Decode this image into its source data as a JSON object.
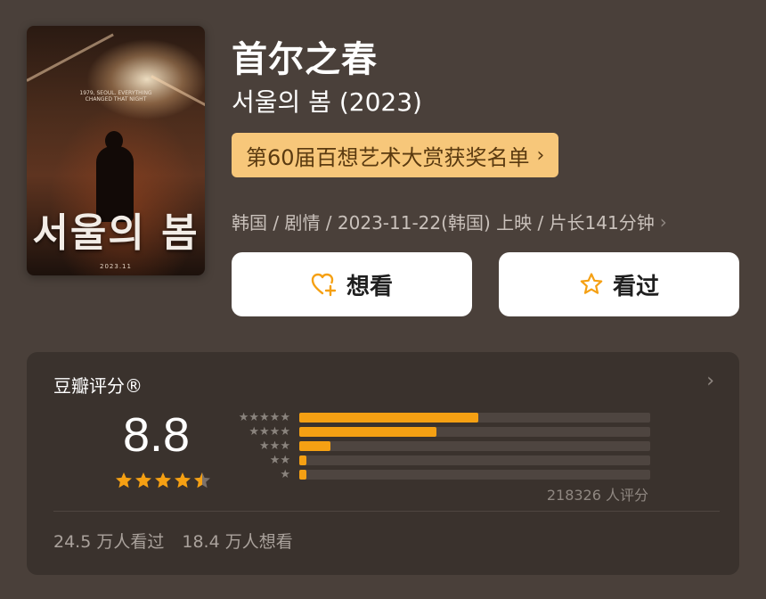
{
  "movie": {
    "title": "首尔之春",
    "original_title": "서울의 봄 (2023)",
    "award_label": "第60届百想艺术大赏获奖名单",
    "meta": "韩国 / 剧情 / 2023-11-22(韩国) 上映 / 片长141分钟"
  },
  "poster": {
    "tagline": "1979, SEOUL. EVERYTHING CHANGED THAT NIGHT",
    "title": "서울의 봄",
    "date": "2023.11"
  },
  "actions": {
    "want_label": "想看",
    "seen_label": "看过"
  },
  "rating": {
    "header": "豆瓣评分®",
    "score": "8.8",
    "stars": 4.5,
    "votes_label": "218326 人评分",
    "distribution": [
      {
        "stars": 5,
        "percent": 51
      },
      {
        "stars": 4,
        "percent": 39
      },
      {
        "stars": 3,
        "percent": 9
      },
      {
        "stars": 2,
        "percent": 2
      },
      {
        "stars": 1,
        "percent": 2
      }
    ]
  },
  "stats": {
    "seen": "24.5 万人看过",
    "want": "18.4 万人想看"
  },
  "colors": {
    "background": "#4a403a",
    "card": "#3a322d",
    "accent": "#f5a013",
    "award_bg": "#f7c77a"
  },
  "icons": {
    "want": "heart-plus-icon",
    "seen": "star-outline-icon",
    "chevron": "chevron-right-icon"
  }
}
